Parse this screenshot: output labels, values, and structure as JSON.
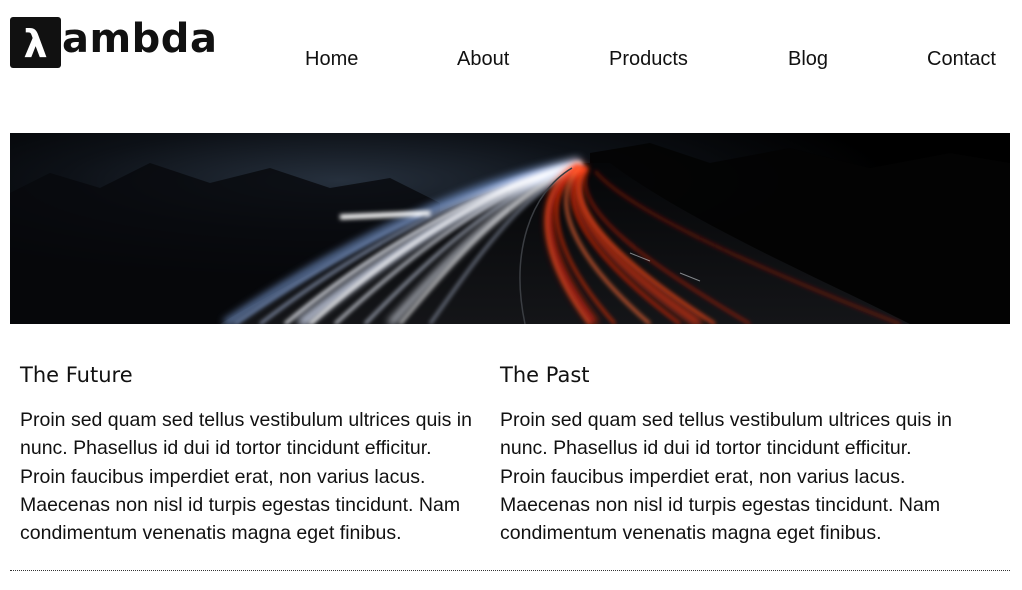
{
  "logo": {
    "mark_glyph": "λ",
    "text": "ambda"
  },
  "nav": {
    "items": [
      {
        "label": "Home"
      },
      {
        "label": "About"
      },
      {
        "label": "Products"
      },
      {
        "label": "Blog"
      },
      {
        "label": "Contact"
      }
    ]
  },
  "hero": {
    "colors": {
      "background": "#000000",
      "light_trails_white": "#f4f7ff",
      "light_trails_blue": "#5a7fb8",
      "light_trails_red": "#ff3a12"
    }
  },
  "columns": [
    {
      "title": "The Future",
      "body": "Proin sed quam sed tellus vestibulum ultrices quis in nunc. Phasellus id dui id tortor tincidunt efficitur. Proin faucibus imperdiet erat, non varius lacus. Maecenas non nisl id turpis egestas tincidunt. Nam condimentum venenatis magna eget finibus."
    },
    {
      "title": "The Past",
      "body": "Proin sed quam sed tellus vestibulum ultrices quis in nunc. Phasellus id dui id tortor tincidunt efficitur. Proin faucibus imperdiet erat, non varius lacus. Maecenas non nisl id turpis egestas tincidunt. Nam condimentum venenatis magna eget finibus."
    }
  ]
}
